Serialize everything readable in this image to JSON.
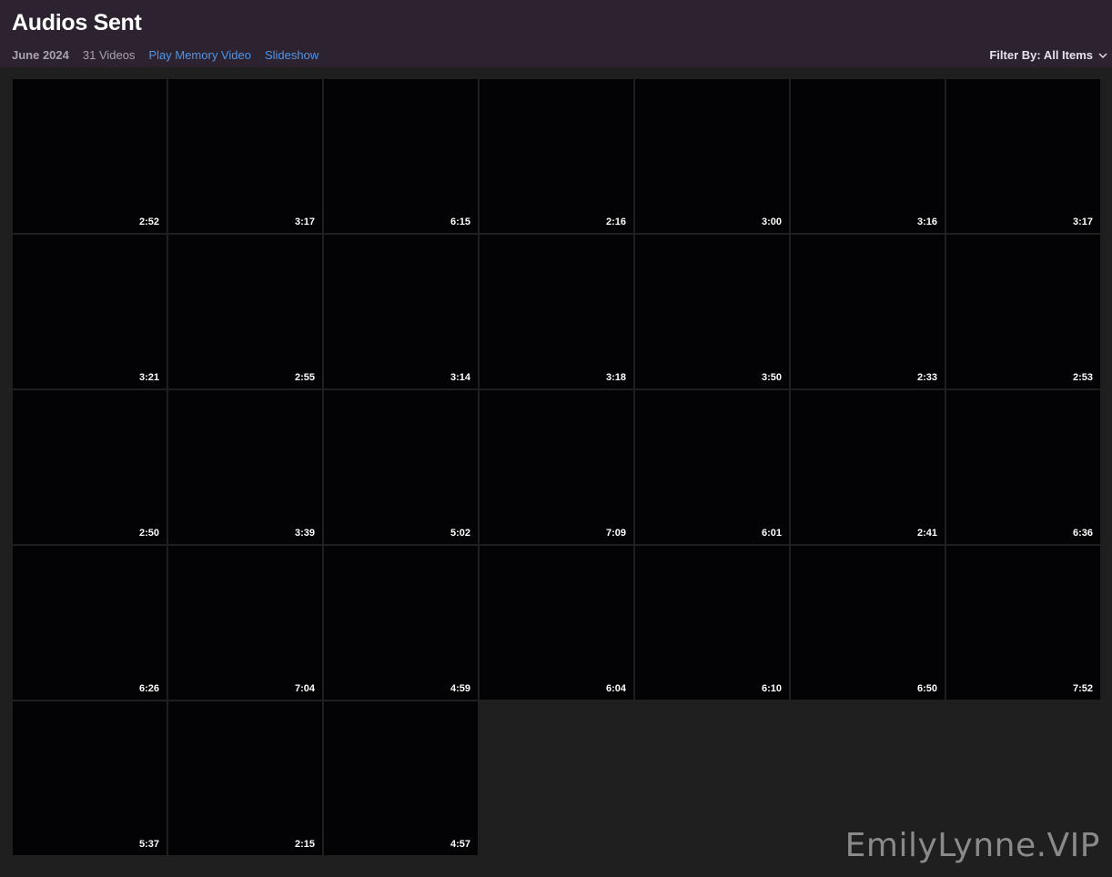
{
  "header": {
    "title": "Audios Sent",
    "date": "June 2024",
    "count": "31 Videos",
    "play_memory": "Play Memory Video",
    "slideshow": "Slideshow",
    "filter_label": "Filter By: All Items"
  },
  "grid": {
    "durations": [
      "2:52",
      "3:17",
      "6:15",
      "2:16",
      "3:00",
      "3:16",
      "3:17",
      "3:21",
      "2:55",
      "3:14",
      "3:18",
      "3:50",
      "2:33",
      "2:53",
      "2:50",
      "3:39",
      "5:02",
      "7:09",
      "6:01",
      "2:41",
      "6:36",
      "6:26",
      "7:04",
      "4:59",
      "6:04",
      "6:10",
      "6:50",
      "7:52",
      "5:37",
      "2:15",
      "4:57"
    ]
  },
  "watermark": "EmilyLynne.VIP",
  "colors": {
    "header_bg": "#2c2230",
    "link": "#4f95e8",
    "page_bg": "#1f1f1f",
    "tile_bg": "#030204"
  }
}
